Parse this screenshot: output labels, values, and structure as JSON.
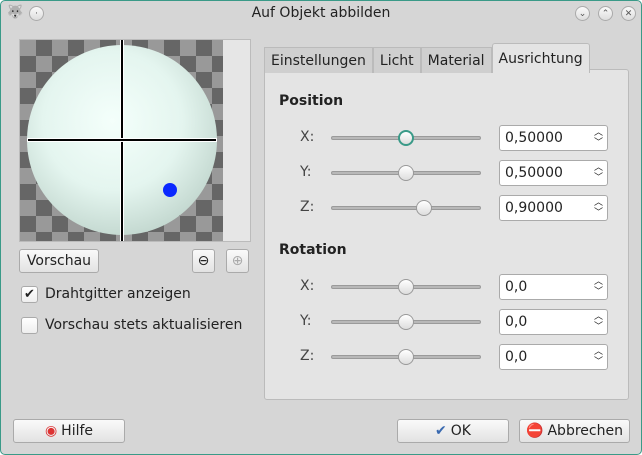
{
  "window": {
    "title": "Auf Objekt abbilden"
  },
  "preview": {
    "button": "Vorschau",
    "wireframe_label": "Drahtgitter anzeigen",
    "wireframe_checked": true,
    "always_update_label": "Vorschau stets aktualisieren",
    "always_update_checked": false
  },
  "tabs": [
    "Einstellungen",
    "Licht",
    "Material",
    "Ausrichtung"
  ],
  "active_tab": "Ausrichtung",
  "position": {
    "title": "Position",
    "rows": [
      {
        "label": "X:",
        "value": "0,50000",
        "fraction": 0.5,
        "focused": true
      },
      {
        "label": "Y:",
        "value": "0,50000",
        "fraction": 0.5
      },
      {
        "label": "Z:",
        "value": "0,90000",
        "fraction": 0.62
      }
    ]
  },
  "rotation": {
    "title": "Rotation",
    "rows": [
      {
        "label": "X:",
        "value": "0,0",
        "fraction": 0.5
      },
      {
        "label": "Y:",
        "value": "0,0",
        "fraction": 0.5
      },
      {
        "label": "Z:",
        "value": "0,0",
        "fraction": 0.5
      }
    ]
  },
  "buttons": {
    "help": "Hilfe",
    "ok": "OK",
    "cancel": "Abbrechen"
  },
  "colors": {
    "accent": "#3a9a88",
    "marker": "#0a28ff"
  }
}
